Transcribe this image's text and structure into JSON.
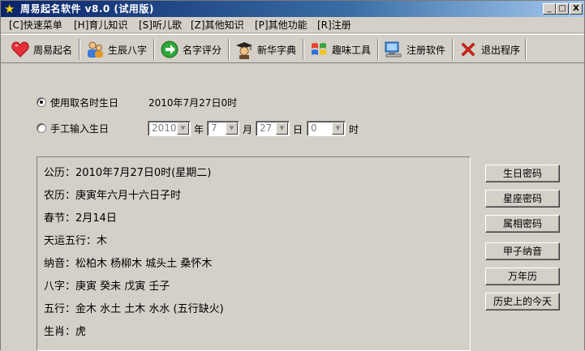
{
  "window": {
    "title": "周易起名软件 v8.0 (试用版)",
    "controls": {
      "minimize": "_",
      "maximize": "□",
      "close": "X"
    }
  },
  "menu": [
    {
      "label": "[C]快速菜单"
    },
    {
      "label": "[H]育儿知识"
    },
    {
      "label": "[S]听儿歌"
    },
    {
      "label": "[Z]其他知识"
    },
    {
      "label": "[P]其他功能"
    },
    {
      "label": "[R]注册"
    }
  ],
  "toolbar": [
    {
      "label": "周易起名",
      "icon": "heart-icon"
    },
    {
      "label": "生辰八字",
      "icon": "people-icon"
    },
    {
      "label": "名字评分",
      "icon": "arrow-right-circle-icon"
    },
    {
      "label": "新华字典",
      "icon": "scholar-icon"
    },
    {
      "label": "趣味工具",
      "icon": "windows-logo-icon"
    },
    {
      "label": "注册软件",
      "icon": "computer-icon"
    },
    {
      "label": "退出程序",
      "icon": "close-x-icon"
    }
  ],
  "birth": {
    "option_use_time": "使用取名时生日",
    "current_date": "2010年7月27日0时",
    "option_manual": "手工输入生日",
    "year_value": "2010",
    "year_label": "年",
    "month_value": "7",
    "month_label": "月",
    "day_value": "27",
    "day_label": "日",
    "hour_value": "0",
    "hour_label": "时"
  },
  "info": {
    "lines": [
      "公历：2010年7月27日0时(星期二)",
      "农历：庚寅年六月十六日子时",
      "春节：2月14日",
      "天运五行：木",
      "纳音：松柏木 杨柳木 城头土 桑怀木",
      "八字：庚寅 癸未 戊寅 壬子",
      "五行：金木 水土 土木 水水 (五行缺火)",
      "生肖：虎"
    ]
  },
  "side_buttons": [
    "生日密码",
    "星座密码",
    "属相密码",
    "甲子纳音",
    "万年历",
    "历史上的今天"
  ]
}
